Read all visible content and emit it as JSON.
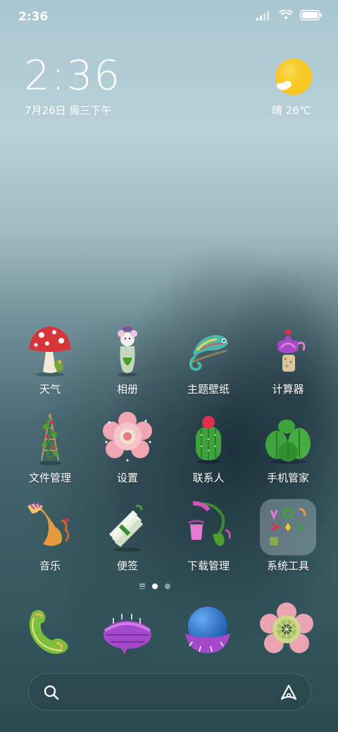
{
  "status_bar": {
    "time": "2:36"
  },
  "lockclock": {
    "time": "2:36",
    "date": "7月26日 周三下午"
  },
  "weather": {
    "condition": "晴",
    "temperature": "26℃",
    "icon": "sunny-cloud-icon"
  },
  "apps": [
    {
      "label": "天气",
      "icon": "mushroom-weather-icon"
    },
    {
      "label": "相册",
      "icon": "mouse-vase-gallery-icon"
    },
    {
      "label": "主题壁纸",
      "icon": "chameleon-theme-icon"
    },
    {
      "label": "计算器",
      "icon": "purple-flower-calculator-icon"
    },
    {
      "label": "文件管理",
      "icon": "vine-trellis-files-icon"
    },
    {
      "label": "设置",
      "icon": "pink-flower-settings-icon"
    },
    {
      "label": "联系人",
      "icon": "cactus-contacts-icon"
    },
    {
      "label": "手机管家",
      "icon": "cactus-cluster-security-icon"
    },
    {
      "label": "音乐",
      "icon": "horn-music-icon"
    },
    {
      "label": "便签",
      "icon": "bundle-notes-icon"
    },
    {
      "label": "下载管理",
      "icon": "pitcher-plant-download-icon"
    },
    {
      "label": "系统工具",
      "icon": "folder-system-tools-icon"
    }
  ],
  "dock": [
    {
      "icon": "phone-icon"
    },
    {
      "icon": "messages-icon"
    },
    {
      "icon": "browser-globe-icon"
    },
    {
      "icon": "camera-flower-icon"
    }
  ],
  "pages": {
    "count": 2,
    "current": 1
  },
  "colors": {
    "sun": "#f7c81e",
    "mushroom_red": "#d8353a",
    "cactus_green": "#3fa33c",
    "purple": "#a349c9"
  }
}
